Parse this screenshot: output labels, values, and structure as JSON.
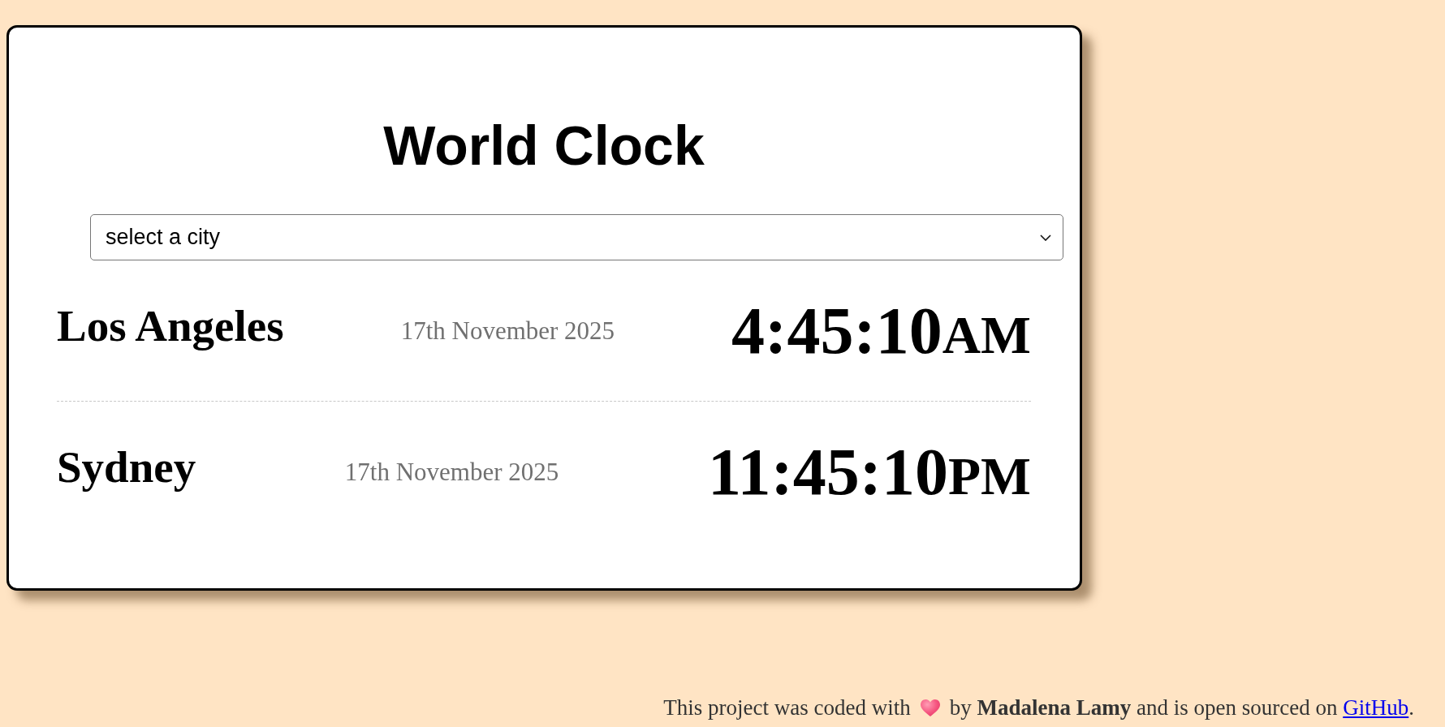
{
  "title": "World Clock",
  "city_select": {
    "selected_option": "select a city"
  },
  "cities": [
    {
      "name": "Los Angeles",
      "date": "17th November 2025",
      "time": "4:45:10",
      "period": "AM"
    },
    {
      "name": "Sydney",
      "date": "17th November 2025",
      "time": "11:45:10",
      "period": "PM"
    }
  ],
  "footer": {
    "text_before": "This project was coded with",
    "text_after": "by **Madalena Lamy** and is open sourced on",
    "link": "GitHub",
    "end": "."
  }
}
